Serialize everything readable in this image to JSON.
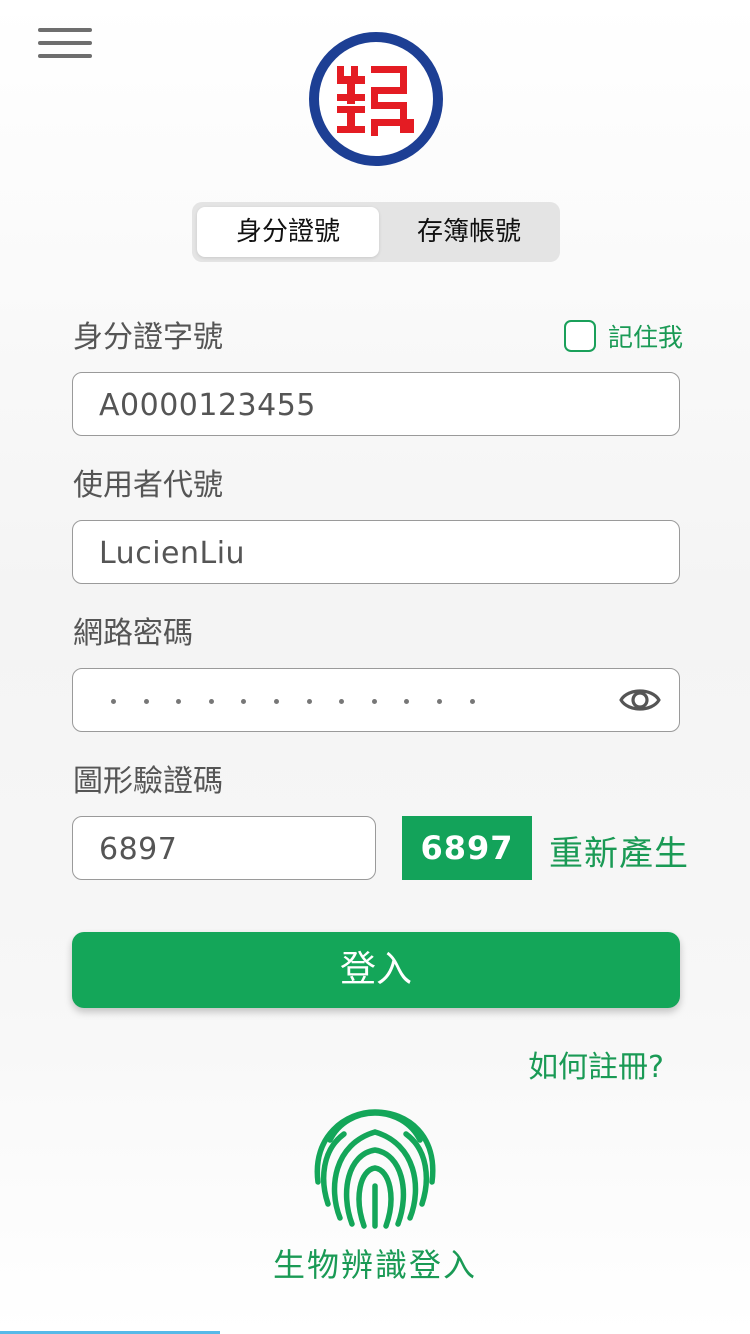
{
  "tabs": [
    {
      "label": "身分證號",
      "active": true
    },
    {
      "label": "存簿帳號",
      "active": false
    }
  ],
  "logo": {
    "text": "郵",
    "accent": "#e41c23",
    "ring": "#1d3f94"
  },
  "id_field": {
    "label": "身分證字號",
    "value": "A0000123455",
    "remember_label": "記住我",
    "remember_checked": false
  },
  "user_field": {
    "label": "使用者代號",
    "value": "LucienLiu"
  },
  "password_field": {
    "label": "網路密碼",
    "masked_length": 12
  },
  "captcha": {
    "label": "圖形驗證碼",
    "value": "6897",
    "image_text": "6897",
    "regenerate_label": "重新產生"
  },
  "login_button": "登入",
  "register_link": "如何註冊?",
  "biometric": {
    "label": "生物辨識登入",
    "icon": "fingerprint-icon"
  },
  "colors": {
    "primary": "#14a659",
    "text_green": "#1a9a55"
  }
}
